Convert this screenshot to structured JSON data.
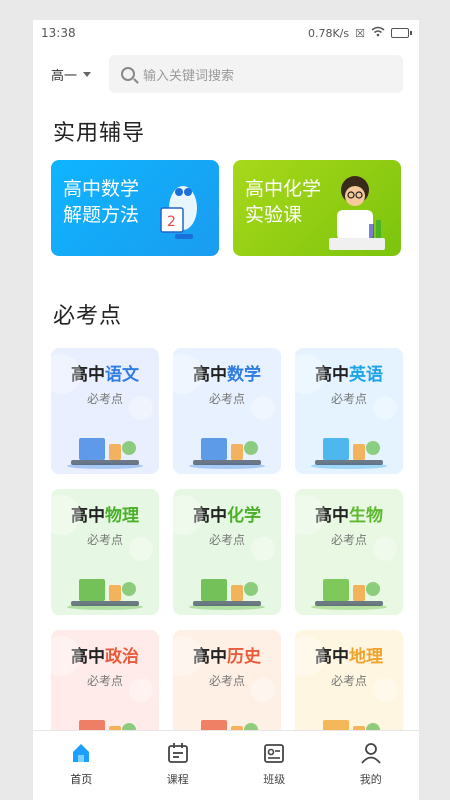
{
  "status": {
    "time": "13:38",
    "speed": "0.78K/s"
  },
  "header": {
    "grade": "高一",
    "search_placeholder": "输入关键词搜索"
  },
  "practical": {
    "title": "实用辅导",
    "banners": [
      {
        "line1": "高中数学",
        "line2": "解题方法",
        "color": "#14aaf8"
      },
      {
        "line1": "高中化学",
        "line2": "实验课",
        "color": "#95cf14"
      }
    ]
  },
  "must": {
    "title": "必考点",
    "cards": [
      {
        "prefix": "高中",
        "subject": "语文",
        "sub": "必考点",
        "color": "#2f7de1",
        "bg": "#e9efff"
      },
      {
        "prefix": "高中",
        "subject": "数学",
        "sub": "必考点",
        "color": "#2f7de1",
        "bg": "#e8f1ff"
      },
      {
        "prefix": "高中",
        "subject": "英语",
        "sub": "必考点",
        "color": "#1ca3e8",
        "bg": "#e4f3ff"
      },
      {
        "prefix": "高中",
        "subject": "物理",
        "sub": "必考点",
        "color": "#4caf2a",
        "bg": "#e6f8e4"
      },
      {
        "prefix": "高中",
        "subject": "化学",
        "sub": "必考点",
        "color": "#4caf2a",
        "bg": "#e6f8e4"
      },
      {
        "prefix": "高中",
        "subject": "生物",
        "sub": "必考点",
        "color": "#5cb82e",
        "bg": "#e8f8e2"
      },
      {
        "prefix": "高中",
        "subject": "政治",
        "sub": "必考点",
        "color": "#ea5a3a",
        "bg": "#ffecea"
      },
      {
        "prefix": "高中",
        "subject": "历史",
        "sub": "必考点",
        "color": "#ea5a3a",
        "bg": "#fff0e6"
      },
      {
        "prefix": "高中",
        "subject": "地理",
        "sub": "必考点",
        "color": "#f0a22c",
        "bg": "#fff6e2"
      }
    ]
  },
  "tabs": [
    {
      "label": "首页",
      "icon": "home-icon",
      "active": true
    },
    {
      "label": "课程",
      "icon": "calendar-icon",
      "active": false
    },
    {
      "label": "班级",
      "icon": "class-card-icon",
      "active": false
    },
    {
      "label": "我的",
      "icon": "person-icon",
      "active": false
    }
  ]
}
